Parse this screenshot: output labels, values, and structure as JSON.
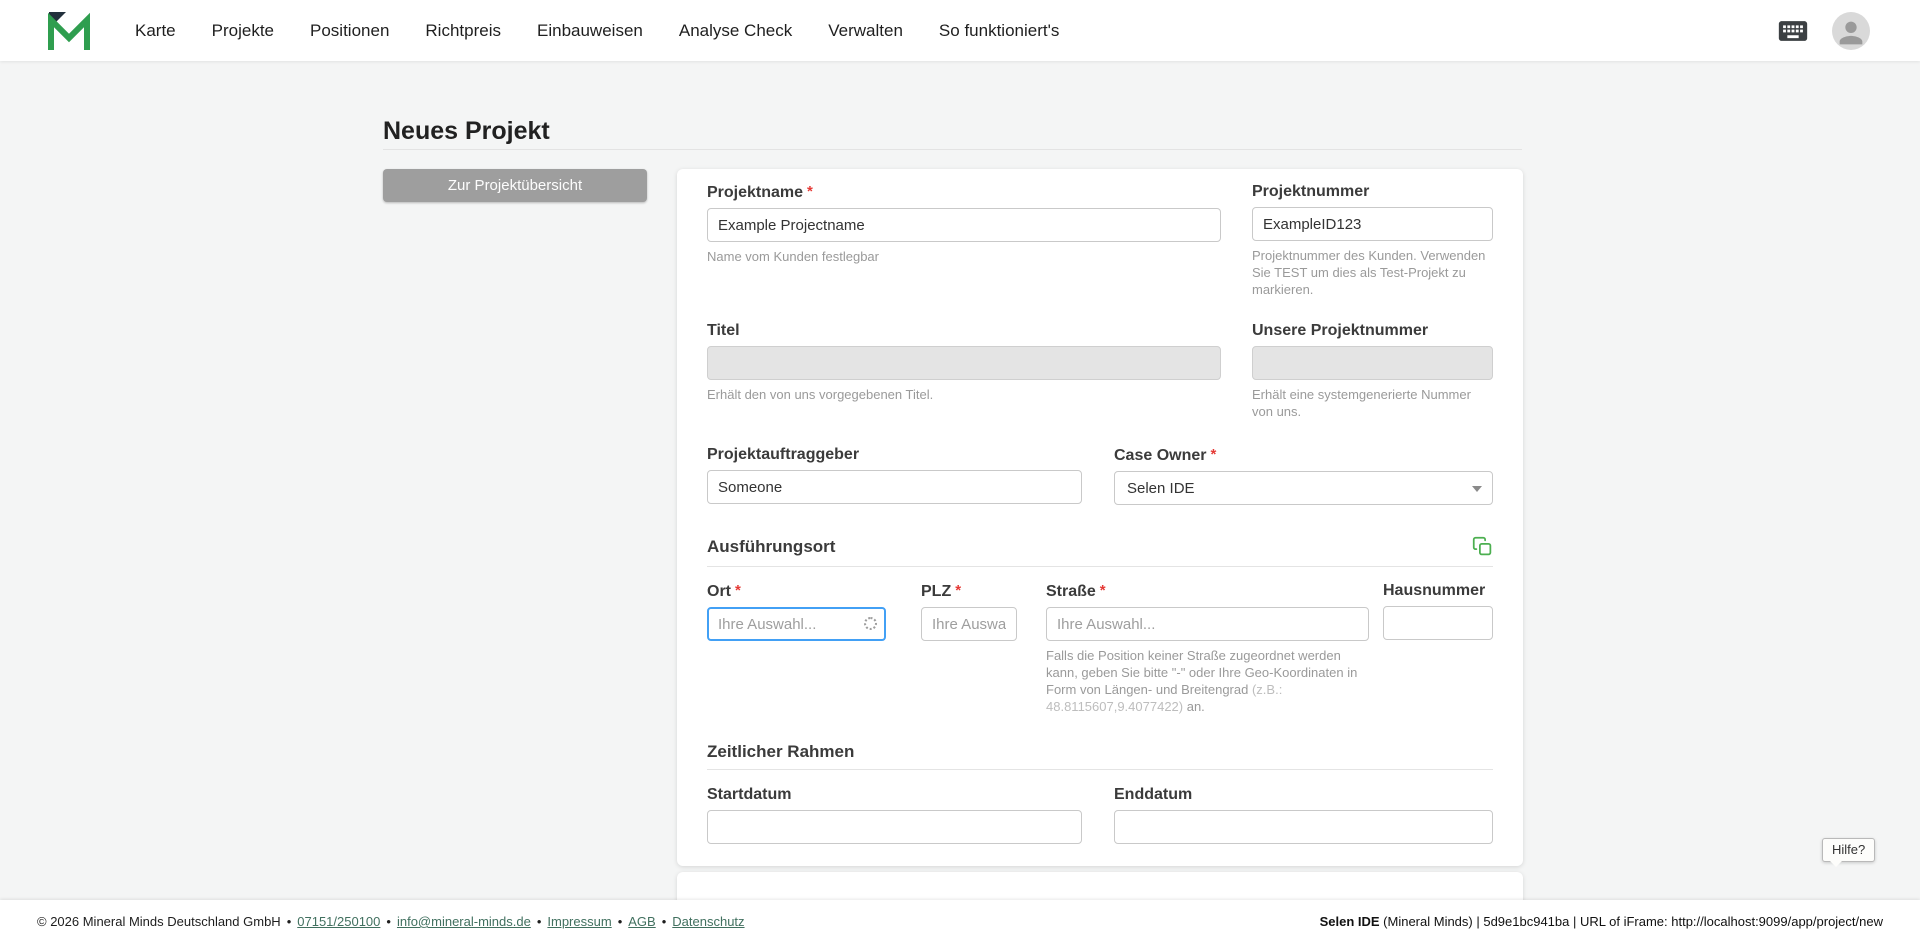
{
  "navbar": {
    "items": [
      "Karte",
      "Projekte",
      "Positionen",
      "Richtpreis",
      "Einbauweisen",
      "Analyse Check",
      "Verwalten",
      "So funktioniert's"
    ]
  },
  "page": {
    "title": "Neues Projekt",
    "back_button": "Zur Projektübersicht"
  },
  "form": {
    "required_mark": "*",
    "projektname": {
      "label": "Projektname",
      "value": "Example Projectname",
      "helper": "Name vom Kunden festlegbar"
    },
    "projektnummer": {
      "label": "Projektnummer",
      "value": "ExampleID123",
      "helper": "Projektnummer des Kunden. Verwenden Sie TEST um dies als Test-Projekt zu markieren."
    },
    "titel": {
      "label": "Titel",
      "helper": "Erhält den von uns vorgegebenen Titel."
    },
    "unsere_projektnummer": {
      "label": "Unsere Projektnummer",
      "helper": "Erhält eine systemgenerierte Nummer von uns."
    },
    "projektauftraggeber": {
      "label": "Projektauftraggeber",
      "value": "Someone"
    },
    "case_owner": {
      "label": "Case Owner",
      "value": "Selen IDE"
    },
    "sections": {
      "ausfuehrungsort": "Ausführungsort",
      "zeitlicher_rahmen": "Zeitlicher Rahmen"
    },
    "ort": {
      "label": "Ort",
      "placeholder": "Ihre Auswahl..."
    },
    "plz": {
      "label": "PLZ",
      "placeholder": "Ihre Auswahl."
    },
    "strasse": {
      "label": "Straße",
      "placeholder": "Ihre Auswahl...",
      "helper_main": "Falls die Position keiner Straße zugeordnet werden kann, geben Sie bitte \"-\" oder Ihre Geo-Koordinaten in Form von Längen- und Breitengrad ",
      "helper_example": "(z.B.: 48.8115607,9.4077422)",
      "helper_suffix": " an."
    },
    "hausnummer": {
      "label": "Hausnummer"
    },
    "startdatum": {
      "label": "Startdatum"
    },
    "enddatum": {
      "label": "Enddatum"
    }
  },
  "help": {
    "label": "Hilfe?"
  },
  "footer": {
    "left": {
      "copyright": "© 2026 Mineral Minds Deutschland GmbH",
      "sep": "•",
      "phone": "07151/250100",
      "email": "info@mineral-minds.de",
      "impressum": "Impressum",
      "agb": "AGB",
      "datenschutz": "Datenschutz"
    },
    "right": {
      "user": "Selen IDE",
      "details": " (Mineral Minds) | 5d9e1bc941ba | URL of iFrame: http://localhost:9099/app/project/new"
    }
  },
  "colors": {
    "brand_green": "#2f9e4f",
    "focus_blue": "#42a0f5",
    "required_red": "#e53935",
    "icon_green": "#4caf50"
  }
}
